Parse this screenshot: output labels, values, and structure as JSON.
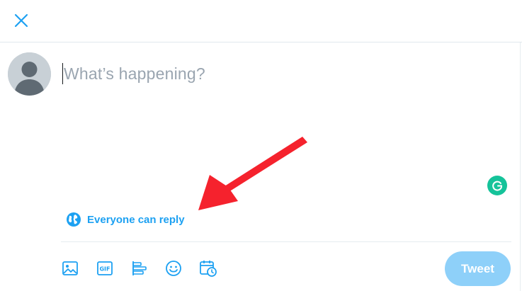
{
  "header": {
    "close_icon": "close-icon"
  },
  "composer": {
    "placeholder": "What’s happening?",
    "avatar": "default-avatar"
  },
  "reply_setting": {
    "icon": "globe-icon",
    "label": "Everyone can reply"
  },
  "toolbar": {
    "icons": [
      "image-icon",
      "gif-icon",
      "poll-icon",
      "emoji-icon",
      "schedule-icon"
    ],
    "tweet_label": "Tweet"
  },
  "extensions": {
    "grammarly_icon": "grammarly-icon"
  },
  "colors": {
    "accent": "#1da1f2",
    "tweet_button_disabled": "#8ed0f9",
    "placeholder": "#9aa5b0",
    "annotation_arrow": "#f5222d",
    "grammarly": "#15c39a"
  }
}
